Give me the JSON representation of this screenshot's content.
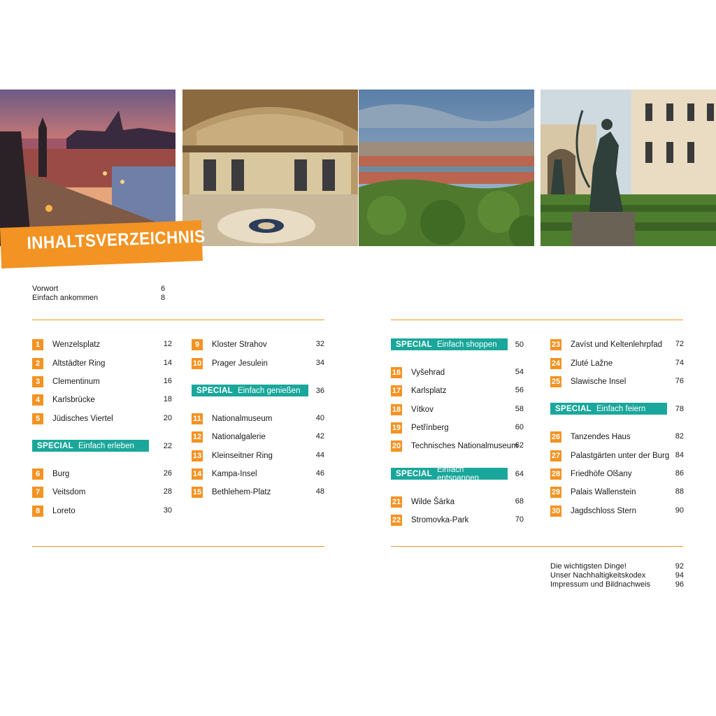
{
  "title": "INHALTSVERZEICHNIS",
  "photos": [
    {
      "icon": "prague-charles-bridge-dusk-photo"
    },
    {
      "icon": "national-museum-hall-photo"
    },
    {
      "icon": "prague-panorama-photo"
    },
    {
      "icon": "wallenstein-garden-statue-photo"
    }
  ],
  "intro": [
    {
      "label": "Vorwort",
      "page": "6"
    },
    {
      "label": "Einfach ankommen",
      "page": "8"
    }
  ],
  "col1": [
    {
      "no": "1",
      "label": "Wenzelsplatz",
      "page": "12"
    },
    {
      "no": "2",
      "label": "Altstädter Ring",
      "page": "14"
    },
    {
      "no": "3",
      "label": "Clementinum",
      "page": "16"
    },
    {
      "no": "4",
      "label": "Karlsbrücke",
      "page": "18"
    },
    {
      "no": "5",
      "label": "Jüdisches Viertel",
      "page": "20"
    },
    {
      "no": "6",
      "label": "Burg",
      "page": "26"
    },
    {
      "no": "7",
      "label": "Veitsdom",
      "page": "28"
    },
    {
      "no": "8",
      "label": "Loreto",
      "page": "30"
    }
  ],
  "col2": [
    {
      "no": "9",
      "label": "Kloster Strahov",
      "page": "32"
    },
    {
      "no": "10",
      "label": "Prager Jesulein",
      "page": "34"
    },
    {
      "no": "11",
      "label": "Nationalmuseum",
      "page": "40"
    },
    {
      "no": "12",
      "label": "Nationalgalerie",
      "page": "42"
    },
    {
      "no": "13",
      "label": "Kleinseitner Ring",
      "page": "44"
    },
    {
      "no": "14",
      "label": "Kampa-Insel",
      "page": "46"
    },
    {
      "no": "15",
      "label": "Bethlehem-Platz",
      "page": "48"
    }
  ],
  "col3": [
    {
      "no": "16",
      "label": "Vyšehrad",
      "page": "54"
    },
    {
      "no": "17",
      "label": "Karlsplatz",
      "page": "56"
    },
    {
      "no": "18",
      "label": "Vítkov",
      "page": "58"
    },
    {
      "no": "19",
      "label": "Petřínberg",
      "page": "60"
    },
    {
      "no": "20",
      "label": "Technisches Nationalmuseum",
      "page": "62"
    },
    {
      "no": "21",
      "label": "Wilde Šárka",
      "page": "68"
    },
    {
      "no": "22",
      "label": "Stromovka-Park",
      "page": "70"
    }
  ],
  "col4": [
    {
      "no": "23",
      "label": "Zavíst und Keltenlehrpfad",
      "page": "72"
    },
    {
      "no": "24",
      "label": "Zluté Lažne",
      "page": "74"
    },
    {
      "no": "25",
      "label": "Slawische Insel",
      "page": "76"
    },
    {
      "no": "26",
      "label": "Tanzendes Haus",
      "page": "82"
    },
    {
      "no": "27",
      "label": "Palastgärten unter der Burg",
      "page": "84"
    },
    {
      "no": "28",
      "label": "Friedhöfe Olšany",
      "page": "86"
    },
    {
      "no": "29",
      "label": "Palais Wallenstein",
      "page": "88"
    },
    {
      "no": "30",
      "label": "Jagdschloss Stern",
      "page": "90"
    }
  ],
  "specials": [
    {
      "tag": "SPECIAL",
      "label": "Einfach erleben",
      "page": "22"
    },
    {
      "tag": "SPECIAL",
      "label": "Einfach genießen",
      "page": "36"
    },
    {
      "tag": "SPECIAL",
      "label": "Einfach shoppen",
      "page": "50"
    },
    {
      "tag": "SPECIAL",
      "label": "Einfach entspannen",
      "page": "64"
    },
    {
      "tag": "SPECIAL",
      "label": "Einfach feiern",
      "page": "78"
    }
  ],
  "outro": [
    {
      "label": "Die wichtigsten Dinge!",
      "page": "92"
    },
    {
      "label": "Unser Nachhaltigkeitskodex",
      "page": "94"
    },
    {
      "label": "Impressum und Bildnachweis",
      "page": "96"
    }
  ],
  "colors": {
    "accent": "#f39323",
    "special": "#1aa79b"
  }
}
